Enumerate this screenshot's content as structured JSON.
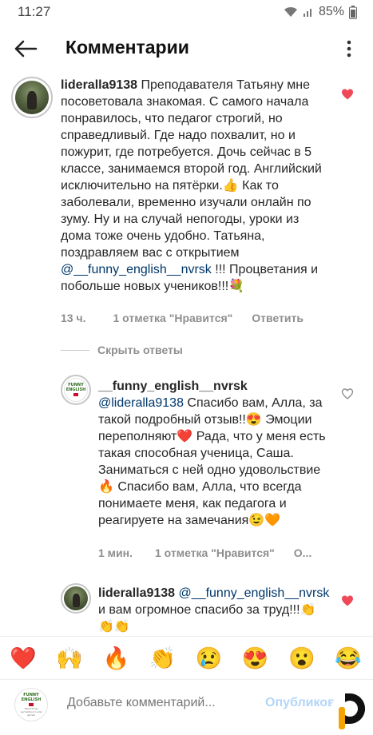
{
  "status_bar": {
    "time": "11:27",
    "battery": "85%"
  },
  "header": {
    "title": "Комментарии"
  },
  "comments": [
    {
      "username": "lideralla9138",
      "text_parts": [
        " Преподавателя Татьяну мне посоветовала знакомая. С самого начала понравилось, что педагог строгий, но справедливый. Где надо похвалит, но и пожурит, где потребуется. Дочь сейчас в 5 классе, занимаемся второй год. Английский исключительно на пятёрки.",
        "👍",
        " Как то заболевали, временно изучали онлайн по зуму. Ну и на случай непогоды, уроки из дома тоже очень удобно. Татьяна, поздравляем вас с открытием ",
        "@__funny_english__nvrsk",
        " !!! Процветания и побольше новых учеников!!!",
        "💐"
      ],
      "time": "13 ч.",
      "likes": "1 отметка \"Нравится\"",
      "reply": "Ответить",
      "liked": true
    },
    {
      "username": "__funny_english__nvrsk",
      "mention": "@lideralla9138",
      "text_parts": [
        " Спасибо вам, Алла, за такой подробный отзыв!!",
        "😍",
        " Эмоции переполняют",
        "❤️",
        " Рада, что у меня есть такая способная ученица, Саша. Заниматься с ней одно удовольствие",
        "🔥",
        " Спасибо вам, Алла, что всегда понимаете меня, как педагога и реагируете на замечания",
        "😉🧡"
      ],
      "time": "1 мин.",
      "likes": "1 отметка \"Нравится\"",
      "reply": "О...",
      "liked": false
    },
    {
      "username": "lideralla9138",
      "mention": "@__funny_english__nvrsk",
      "text_parts": [
        " и вам огромное спасибо за труд!!!",
        "👏👏👏"
      ],
      "liked": true
    }
  ],
  "logo": {
    "line1": "FUNNY",
    "line2": "ENGLISH",
    "sub": "Репетитор английского для детей"
  },
  "hide_replies": "Скрыть ответы",
  "emoji_bar": [
    "❤️",
    "🙌",
    "🔥",
    "👏",
    "😢",
    "😍",
    "😮",
    "😂"
  ],
  "composer": {
    "placeholder": "Добавьте комментарий...",
    "publish": "Опубликовать"
  },
  "colors": {
    "like_red": "#ed4956",
    "mention_blue": "#00376b",
    "publish_blue": "#b3d6f7",
    "meta_gray": "#8e8e8e"
  }
}
